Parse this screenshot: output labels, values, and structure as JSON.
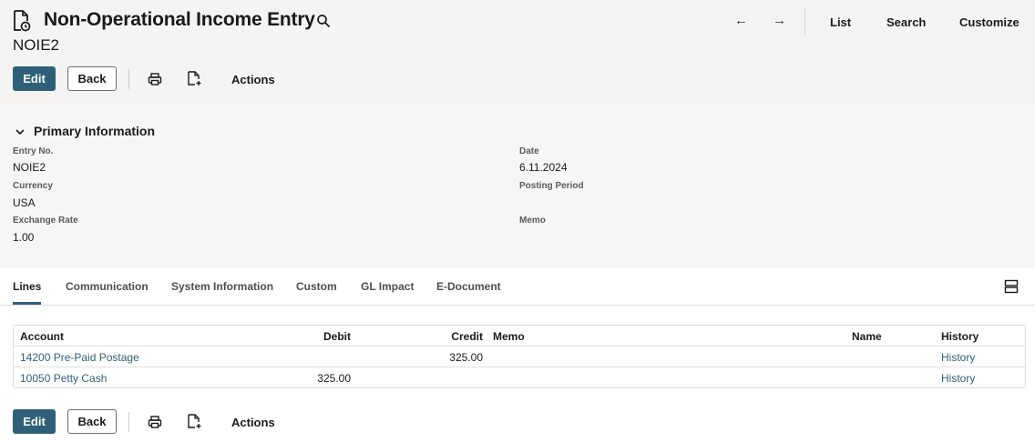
{
  "header": {
    "title": "Non-Operational Income Entry",
    "record_id": "NOIE2",
    "nav": {
      "prev_label": "←",
      "next_label": "→",
      "list_label": "List",
      "search_label": "Search",
      "customize_label": "Customize"
    }
  },
  "toolbar": {
    "edit_label": "Edit",
    "back_label": "Back",
    "actions_label": "Actions"
  },
  "primary_info": {
    "title": "Primary Information",
    "fields": {
      "entry_no": {
        "label": "Entry No.",
        "value": "NOIE2"
      },
      "currency": {
        "label": "Currency",
        "value": "USA"
      },
      "exchange_rate": {
        "label": "Exchange Rate",
        "value": "1.00"
      },
      "date": {
        "label": "Date",
        "value": "6.11.2024"
      },
      "posting_period": {
        "label": "Posting Period",
        "value": ""
      },
      "memo": {
        "label": "Memo",
        "value": ""
      }
    }
  },
  "tabs": [
    {
      "label": "Lines",
      "active": true
    },
    {
      "label": "Communication"
    },
    {
      "label": "System Information"
    },
    {
      "label": "Custom"
    },
    {
      "label": "GL Impact"
    },
    {
      "label": "E-Document"
    }
  ],
  "lines_table": {
    "columns": [
      "Account",
      "Debit",
      "Credit",
      "Memo",
      "Name",
      "History"
    ],
    "rows": [
      {
        "account": "14200 Pre-Paid Postage",
        "debit": "",
        "credit": "325.00",
        "memo": "",
        "name": "",
        "history": "History"
      },
      {
        "account": "10050 Petty Cash",
        "debit": "325.00",
        "credit": "",
        "memo": "",
        "name": "",
        "history": "History"
      }
    ]
  },
  "colors": {
    "primary": "#2f6079",
    "header_bg": "#f5f4f2",
    "link": "#2f6079"
  },
  "icons": [
    "record-document-icon",
    "search-icon",
    "print-icon",
    "new-document-icon",
    "chevron-down-icon",
    "layout-toggle-icon"
  ]
}
